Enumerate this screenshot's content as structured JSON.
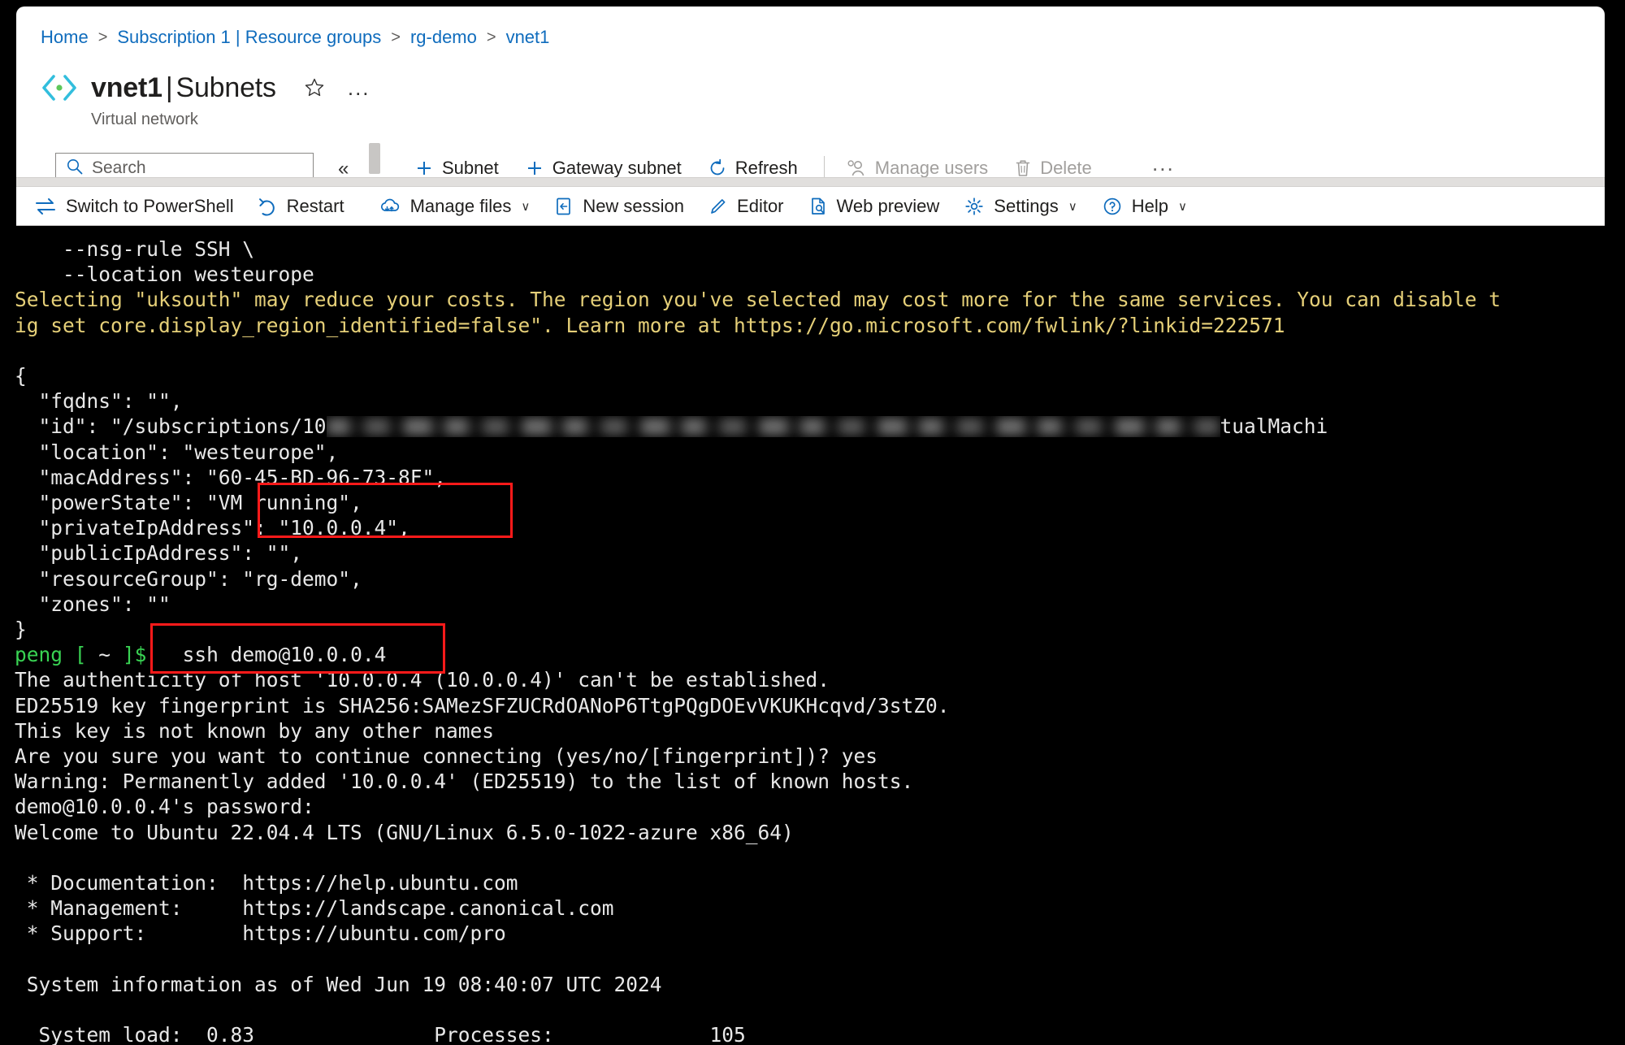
{
  "portal": {
    "breadcrumb": {
      "items": [
        "Home",
        "Subscription 1 | Resource groups",
        "rg-demo",
        "vnet1"
      ],
      "separator": ">"
    },
    "title": {
      "resource": "vnet1",
      "divider": "|",
      "section": "Subnets",
      "subtitle": "Virtual network",
      "icon": "virtual-network-icon",
      "favorite_icon": "star-outline-icon",
      "more_label": "..."
    },
    "search": {
      "placeholder": "Search",
      "icon": "search-icon"
    },
    "collapse_label": "«",
    "commands": [
      {
        "label": "Subnet",
        "icon": "plus-icon",
        "disabled": false
      },
      {
        "label": "Gateway subnet",
        "icon": "plus-icon",
        "disabled": false
      },
      {
        "label": "Refresh",
        "icon": "refresh-icon",
        "disabled": false
      },
      {
        "label": "Manage users",
        "icon": "people-icon",
        "disabled": true
      },
      {
        "label": "Delete",
        "icon": "trash-icon",
        "disabled": true
      }
    ],
    "overflow_label": "..."
  },
  "cloudshell": {
    "toolbar": [
      {
        "label": "Switch to PowerShell",
        "icon": "swap-icon",
        "caret": false
      },
      {
        "label": "Restart",
        "icon": "restart-icon",
        "caret": false
      },
      {
        "label": "Manage files",
        "icon": "cloud-sync-icon",
        "caret": true
      },
      {
        "label": "New session",
        "icon": "new-window-icon",
        "caret": false
      },
      {
        "label": "Editor",
        "icon": "pencil-icon",
        "caret": false
      },
      {
        "label": "Web preview",
        "icon": "web-preview-icon",
        "caret": false
      },
      {
        "label": "Settings",
        "icon": "gear-icon",
        "caret": true
      },
      {
        "label": "Help",
        "icon": "question-icon",
        "caret": true
      }
    ],
    "caret_glyph": "∨"
  },
  "terminal": {
    "lines": [
      {
        "text": "    --nsg-rule SSH \\",
        "color": "white"
      },
      {
        "text": "    --location westeurope",
        "color": "white"
      },
      {
        "text": "Selecting \"uksouth\" may reduce your costs. The region you've selected may cost more for the same services. You can disable t",
        "color": "yellow"
      },
      {
        "text": "ig set core.display_region_identified=false\". Learn more at https://go.microsoft.com/fwlink/?linkid=222571",
        "color": "yellow"
      },
      {
        "text": "",
        "color": "white"
      },
      {
        "text": "{",
        "color": "white"
      },
      {
        "text": "  \"fqdns\": \"\",",
        "color": "white"
      },
      {
        "text": "  \"id\": \"/subscriptions/10",
        "color": "white",
        "redacted": true,
        "suffix": "tualMachi"
      },
      {
        "text": "  \"location\": \"westeurope\",",
        "color": "white"
      },
      {
        "text": "  \"macAddress\": \"60-45-BD-96-73-8F\",",
        "color": "white"
      },
      {
        "text": "  \"powerState\": \"VM running\",",
        "color": "white"
      },
      {
        "text": "  \"privateIpAddress\": \"10.0.0.4\",",
        "color": "white"
      },
      {
        "text": "  \"publicIpAddress\": \"\",",
        "color": "white"
      },
      {
        "text": "  \"resourceGroup\": \"rg-demo\",",
        "color": "white"
      },
      {
        "text": "  \"zones\": \"\"",
        "color": "white"
      },
      {
        "text": "}",
        "color": "white"
      },
      {
        "text": "",
        "color": "white",
        "prompt": true
      },
      {
        "text": "The authenticity of host '10.0.0.4 (10.0.0.4)' can't be established.",
        "color": "white"
      },
      {
        "text": "ED25519 key fingerprint is SHA256:SAMezSFZUCRdOANoP6TtgPQgDOEvVKUKHcqvd/3stZ0.",
        "color": "white"
      },
      {
        "text": "This key is not known by any other names",
        "color": "white"
      },
      {
        "text": "Are you sure you want to continue connecting (yes/no/[fingerprint])? yes",
        "color": "white"
      },
      {
        "text": "Warning: Permanently added '10.0.0.4' (ED25519) to the list of known hosts.",
        "color": "white"
      },
      {
        "text": "demo@10.0.0.4's password:",
        "color": "white"
      },
      {
        "text": "Welcome to Ubuntu 22.04.4 LTS (GNU/Linux 6.5.0-1022-azure x86_64)",
        "color": "white"
      },
      {
        "text": "",
        "color": "white"
      },
      {
        "text": " * Documentation:  https://help.ubuntu.com",
        "color": "white"
      },
      {
        "text": " * Management:     https://landscape.canonical.com",
        "color": "white"
      },
      {
        "text": " * Support:        https://ubuntu.com/pro",
        "color": "white"
      },
      {
        "text": "",
        "color": "white"
      },
      {
        "text": " System information as of Wed Jun 19 08:40:07 UTC 2024",
        "color": "white"
      },
      {
        "text": "",
        "color": "white"
      },
      {
        "text": "  System load:  0.83               Processes:             105",
        "color": "white"
      }
    ],
    "prompt": {
      "user": "peng",
      "bracket_open": "[",
      "cwd": "~",
      "bracket_close": "]$",
      "command": "ssh demo@10.0.0.4"
    }
  },
  "annotations": {
    "highlight_color": "#ff1a1a",
    "boxes": [
      {
        "name": "private-ip-highlight",
        "target": "\"privateIpAddress\": \"10.0.0.4\""
      },
      {
        "name": "ssh-command-highlight",
        "target": "ssh demo@10.0.0.4"
      }
    ]
  }
}
